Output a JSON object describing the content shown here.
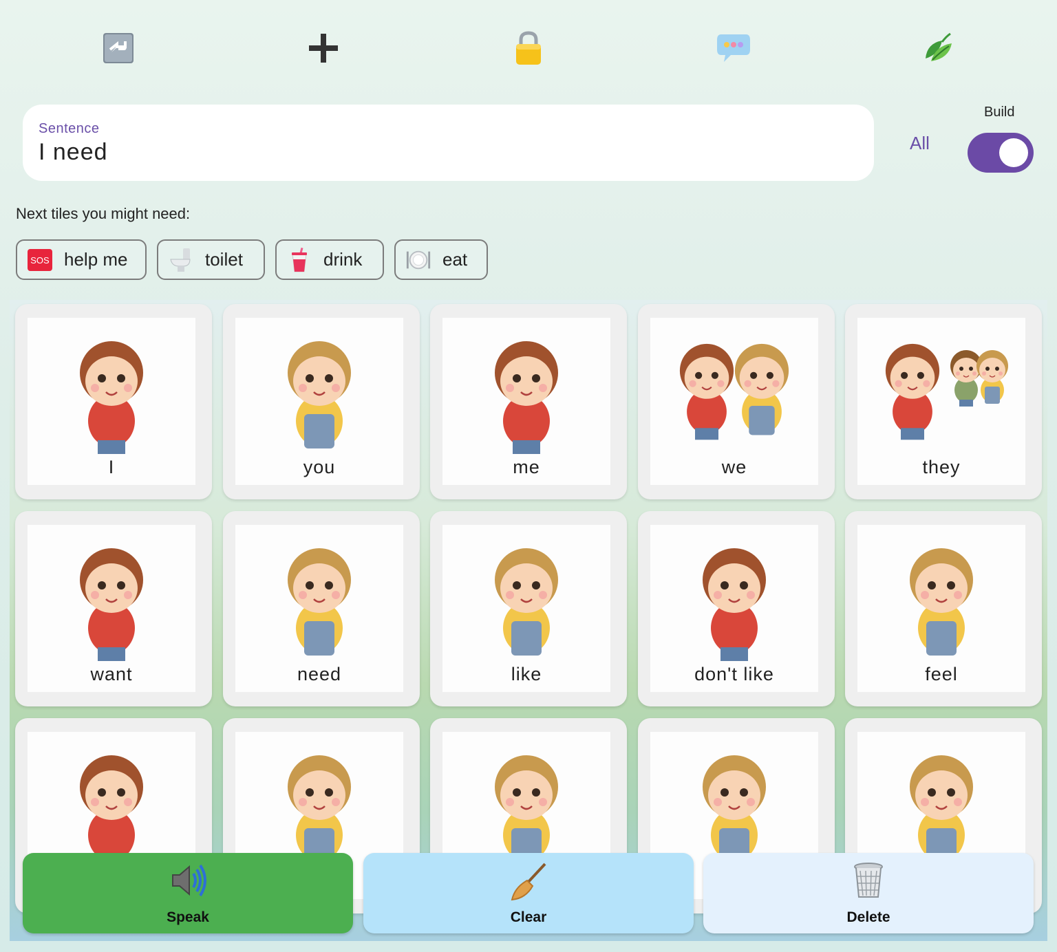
{
  "toolbar": {
    "icons": [
      "return-icon",
      "plus-icon",
      "padlock-icon",
      "speech-bubble-icon",
      "leaf-icon"
    ]
  },
  "sentence": {
    "label": "Sentence",
    "text": "I need"
  },
  "mode": {
    "all_label": "All",
    "build_label": "Build",
    "build_on": true
  },
  "suggestions": {
    "label": "Next tiles you might need:",
    "chips": [
      {
        "label": "help me",
        "icon": "sos-icon"
      },
      {
        "label": "toilet",
        "icon": "toilet-icon"
      },
      {
        "label": "drink",
        "icon": "cup-icon"
      },
      {
        "label": "eat",
        "icon": "plate-icon"
      }
    ]
  },
  "tiles": [
    {
      "label": "I",
      "figure": "boy"
    },
    {
      "label": "you",
      "figure": "girl"
    },
    {
      "label": "me",
      "figure": "boy"
    },
    {
      "label": "we",
      "figure": "pair"
    },
    {
      "label": "they",
      "figure": "group"
    },
    {
      "label": "want",
      "figure": "boy"
    },
    {
      "label": "need",
      "figure": "girl"
    },
    {
      "label": "like",
      "figure": "girl"
    },
    {
      "label": "don't like",
      "figure": "boy"
    },
    {
      "label": "feel",
      "figure": "girl"
    },
    {
      "label": "",
      "figure": "boy"
    },
    {
      "label": "",
      "figure": "girl"
    },
    {
      "label": "",
      "figure": "girl"
    },
    {
      "label": "",
      "figure": "girl"
    },
    {
      "label": "",
      "figure": "girl"
    }
  ],
  "actions": {
    "speak": "Speak",
    "clear": "Clear",
    "delete": "Delete"
  },
  "colors": {
    "accent": "#6b4aa6",
    "speak": "#4caf50",
    "clear": "#b5e3fa",
    "delete": "#e4f1fd"
  }
}
